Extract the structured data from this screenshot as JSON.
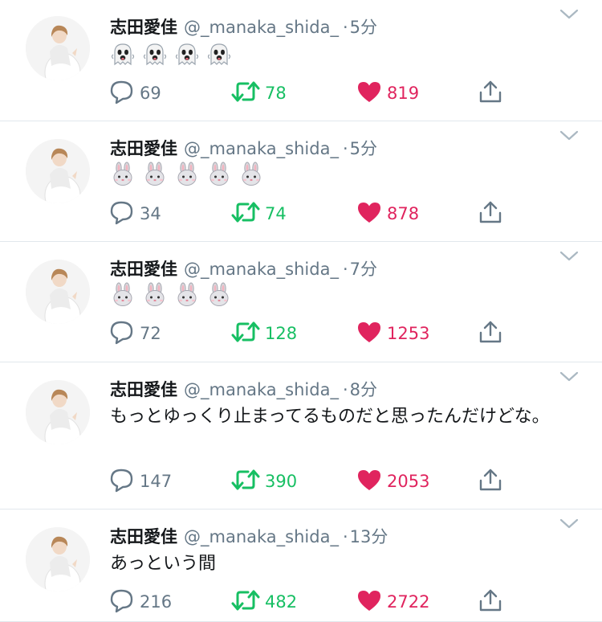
{
  "tweets": [
    {
      "name": "志田愛佳",
      "handle": "@_manaka_shida_",
      "dot": "·",
      "time": "5分",
      "emoji": [
        "ghost-emoji",
        "ghost-emoji",
        "ghost-emoji",
        "ghost-emoji"
      ],
      "text": "",
      "replies": "69",
      "retweets": "78",
      "likes": "819"
    },
    {
      "name": "志田愛佳",
      "handle": "@_manaka_shida_",
      "dot": "·",
      "time": "5分",
      "emoji": [
        "rabbit-face-emoji",
        "rabbit-face-emoji",
        "rabbit-face-emoji",
        "rabbit-face-emoji",
        "rabbit-face-emoji"
      ],
      "text": "",
      "replies": "34",
      "retweets": "74",
      "likes": "878"
    },
    {
      "name": "志田愛佳",
      "handle": "@_manaka_shida_",
      "dot": "·",
      "time": "7分",
      "emoji": [
        "rabbit-face-emoji",
        "rabbit-face-emoji",
        "rabbit-face-emoji",
        "rabbit-face-emoji"
      ],
      "text": "",
      "replies": "72",
      "retweets": "128",
      "likes": "1253"
    },
    {
      "name": "志田愛佳",
      "handle": "@_manaka_shida_",
      "dot": "·",
      "time": "8分",
      "emoji": [],
      "text": "もっとゆっくり止まってるものだと思ったんだけどな。",
      "replies": "147",
      "retweets": "390",
      "likes": "2053"
    },
    {
      "name": "志田愛佳",
      "handle": "@_manaka_shida_",
      "dot": "·",
      "time": "13分",
      "emoji": [],
      "text": "あっという間",
      "replies": "216",
      "retweets": "482",
      "likes": "2722"
    }
  ],
  "colors": {
    "reply": "#657786",
    "retweet": "#17bf63",
    "like": "#e0245e",
    "text": "#14171a",
    "muted": "#657786",
    "divider": "#e1e8ed"
  },
  "icons": {
    "reply": "reply-bubble-icon",
    "retweet": "retweet-arrows-icon",
    "like": "heart-icon",
    "share": "share-upload-icon",
    "caret": "chevron-down-icon"
  }
}
